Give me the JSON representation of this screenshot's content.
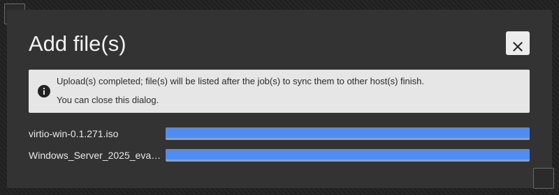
{
  "dialog": {
    "title": "Add file(s)",
    "close_icon": "close-x-icon",
    "alert": {
      "icon": "info-circle-icon",
      "line1": "Upload(s) completed; file(s) will be listed after the job(s) to sync them to other host(s) finish.",
      "line2": "You can close this dialog."
    },
    "files": [
      {
        "name": "virtio-win-0.1.271.iso",
        "progress_percent": 100
      },
      {
        "name": "Windows_Server_2025_eval_x…",
        "progress_percent": 100
      }
    ]
  },
  "colors": {
    "dialog_bg": "#333333",
    "alert_bg": "#e6e6e6",
    "progress_fill": "#4f8df3",
    "progress_track": "#9aa0a6"
  }
}
